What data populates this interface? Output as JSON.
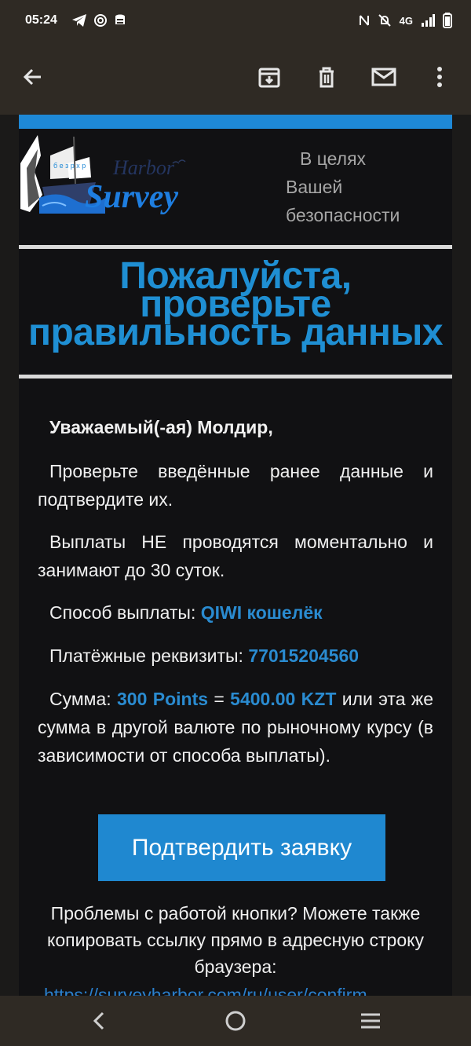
{
  "status_bar": {
    "time": "05:24",
    "network": "4G",
    "icons": [
      "telegram-icon",
      "at-icon",
      "data-saver-icon",
      "nfc-icon",
      "notifications-off-icon",
      "signal-icon",
      "battery-icon"
    ]
  },
  "toolbar": {
    "icons": [
      "back-arrow-icon",
      "archive-icon",
      "delete-icon",
      "mark-unread-icon",
      "more-vert-icon"
    ]
  },
  "email": {
    "logo": {
      "word1": "Harbor",
      "word2": "Survey",
      "sail_text": "б е з р х р"
    },
    "security_line1": "В целях",
    "security_line2": "Вашей",
    "security_line3": "безопасности",
    "headline_line1": "Пожалуйста,",
    "headline_line2": "проверьте",
    "headline_line3": "правильность данных",
    "greeting": "Уважаемый(-ая) Молдир,",
    "paragraph1": "Проверьте введённые ранее данные и подтвердите их.",
    "paragraph2": "Выплаты НЕ проводятся моментально и занимают до 30 суток.",
    "payout_method_label": "Способ выплаты: ",
    "payout_method_value": "QIWI кошелёк",
    "payment_details_label": "Платёжные реквизиты: ",
    "payment_details_value": "77015204560",
    "sum_label": "Сумма: ",
    "sum_points": "300 Points",
    "sum_equals": " = ",
    "sum_kzt": "5400.00 KZT",
    "sum_rest": " или эта же сумма в другой валюте по рыночному курсу (в зависимости от способа выплаты).",
    "confirm_button": "Подтвердить заявку",
    "help_text": "Проблемы с работой кнопки? Можете также копировать ссылку прямо в адресную строку браузера:",
    "link_text": "https://surveyharbor.com/ru/user/confirm"
  },
  "colors": {
    "accent": "#1f8fd3",
    "button": "#1f88d0",
    "app_bar": "#2f2a24",
    "card_bg": "#111113"
  }
}
